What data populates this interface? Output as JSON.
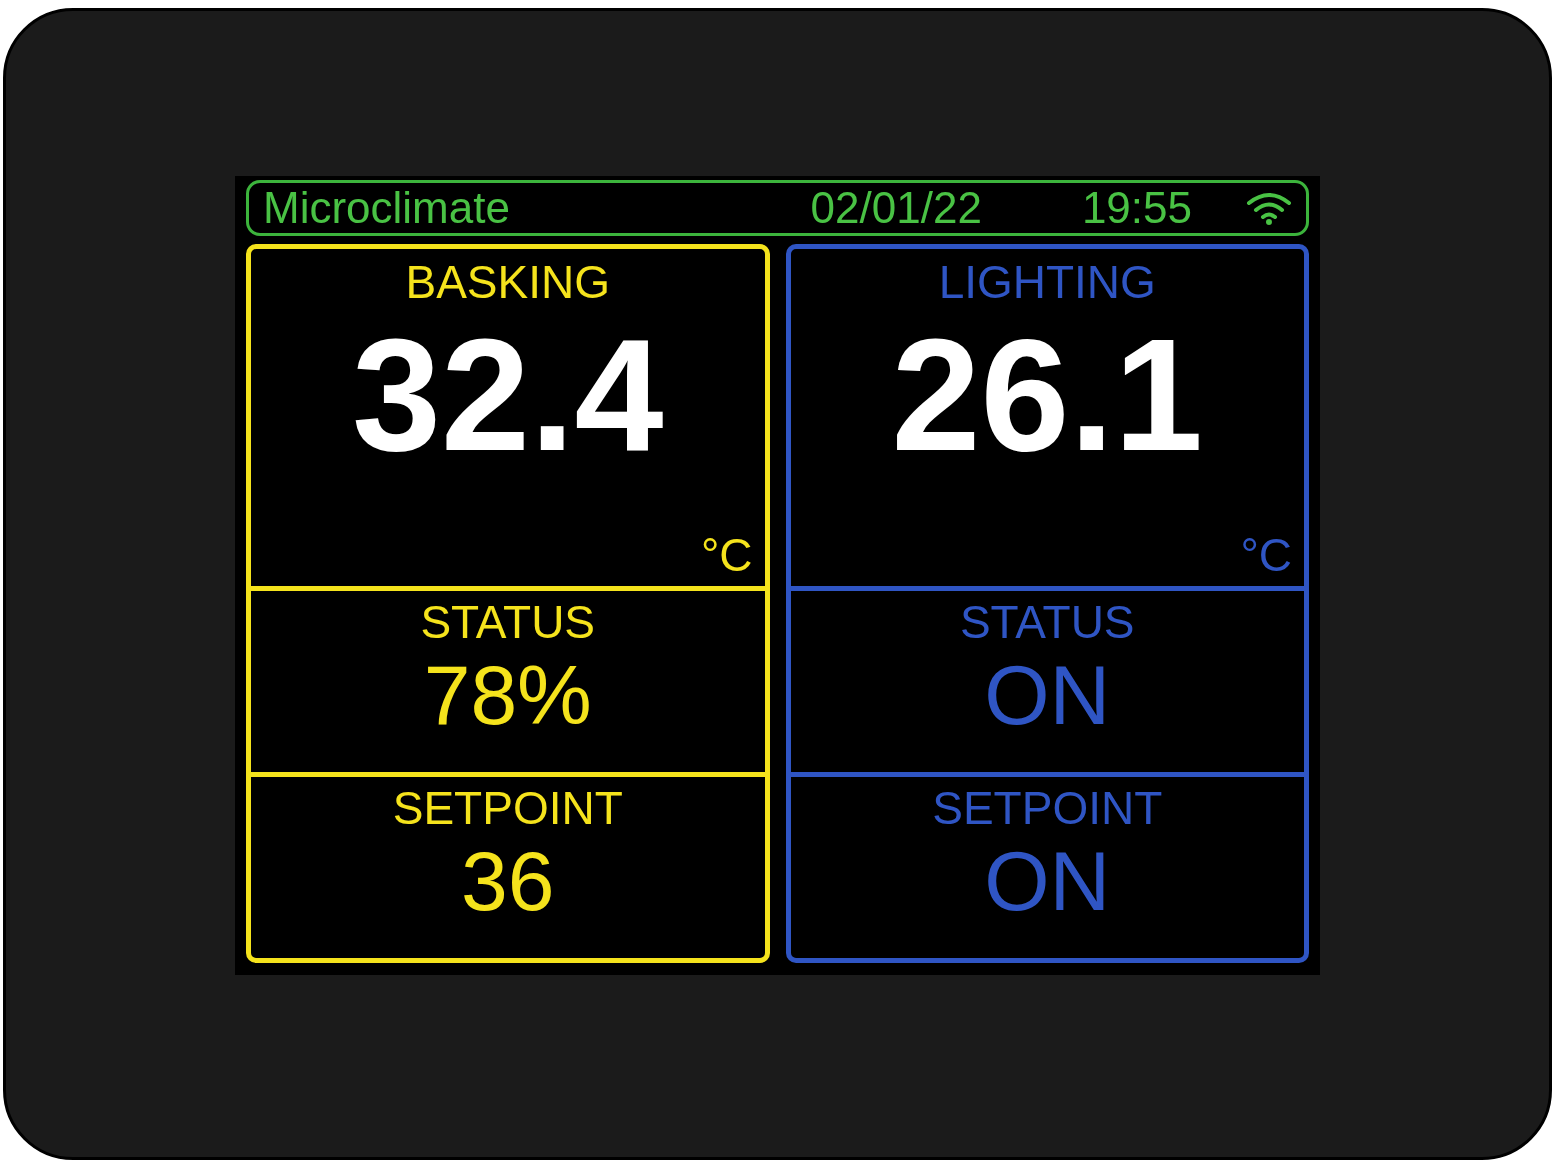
{
  "header": {
    "title": "Microclimate",
    "date": "02/01/22",
    "time": "19:55",
    "wifi": true
  },
  "panels": [
    {
      "color": "#f5e31c",
      "title": "BASKING",
      "value": "32.4",
      "unit": "°C",
      "status_label": "STATUS",
      "status_value": "78%",
      "setpoint_label": "SETPOINT",
      "setpoint_value": "36"
    },
    {
      "color": "#2f55c4",
      "title": "LIGHTING",
      "value": "26.1",
      "unit": "°C",
      "status_label": "STATUS",
      "status_value": "ON",
      "setpoint_label": "SETPOINT",
      "setpoint_value": "ON"
    }
  ]
}
